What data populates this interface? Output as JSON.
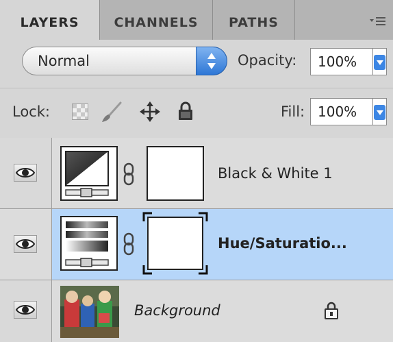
{
  "tabs": [
    {
      "label": "LAYERS",
      "active": true
    },
    {
      "label": "CHANNELS",
      "active": false
    },
    {
      "label": "PATHS",
      "active": false
    }
  ],
  "blend_mode": {
    "value": "Normal"
  },
  "opacity": {
    "label": "Opacity:",
    "value": "100%"
  },
  "lock": {
    "label": "Lock:",
    "icons": [
      "lock-transparent-pixels-icon",
      "lock-image-pixels-icon",
      "lock-position-icon",
      "lock-all-icon"
    ]
  },
  "fill": {
    "label": "Fill:",
    "value": "100%"
  },
  "layers": [
    {
      "name": "Black & White 1",
      "visible": true,
      "selected": false,
      "type": "adjustment",
      "icon": "black-white-adjustment-icon"
    },
    {
      "name": "Hue/Saturatio...",
      "visible": true,
      "selected": true,
      "type": "adjustment",
      "icon": "hue-saturation-adjustment-icon"
    },
    {
      "name": "Background",
      "visible": true,
      "selected": false,
      "type": "image",
      "locked": true
    }
  ],
  "colors": {
    "selection": "#b6d6f9",
    "accent": "#2e77d6",
    "panel": "#d6d6d6"
  }
}
